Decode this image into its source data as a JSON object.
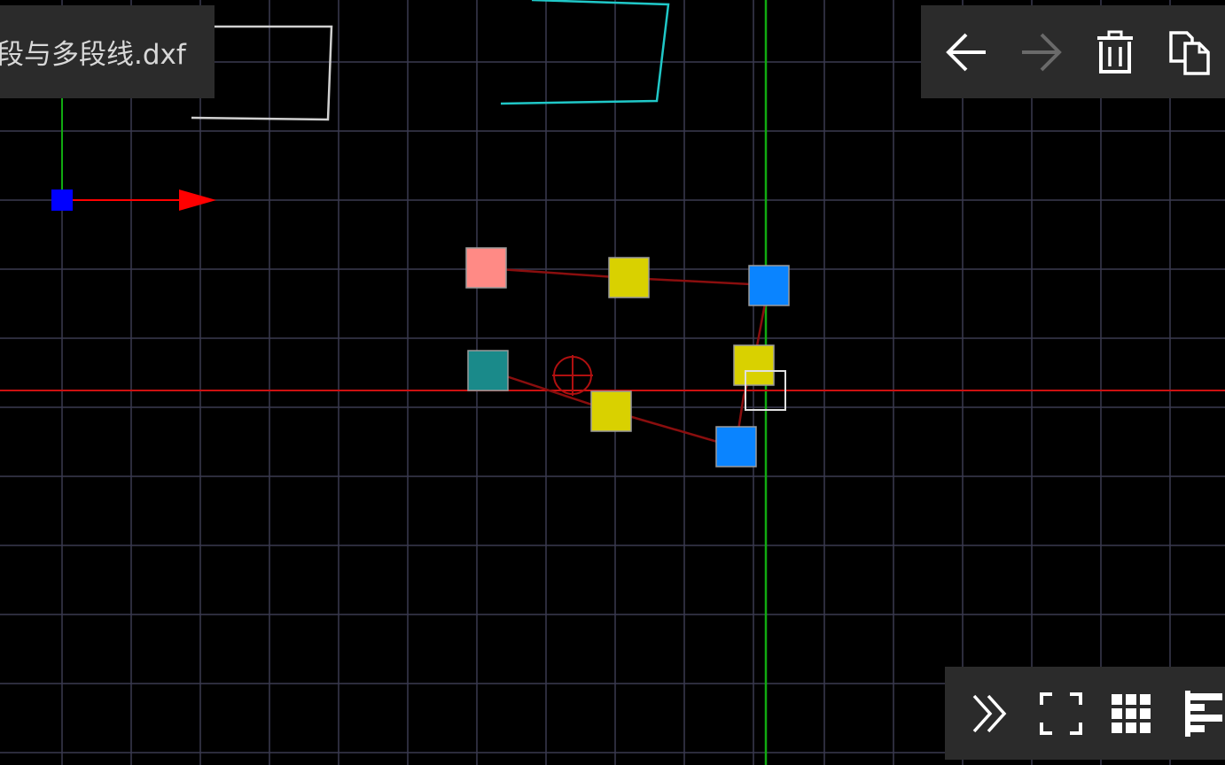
{
  "document": {
    "title": "段与多段线.dxf"
  },
  "toolbar_top": {
    "items": [
      {
        "name": "undo",
        "icon": "arrow-left-icon",
        "enabled": true
      },
      {
        "name": "redo",
        "icon": "arrow-right-icon",
        "enabled": false
      },
      {
        "name": "delete",
        "icon": "trash-icon",
        "enabled": true
      },
      {
        "name": "copy",
        "icon": "copy-icon",
        "enabled": true
      }
    ]
  },
  "toolbar_bottom": {
    "items": [
      {
        "name": "expand",
        "icon": "double-chevron-right-icon"
      },
      {
        "name": "fullscreen",
        "icon": "fullscreen-icon"
      },
      {
        "name": "grid",
        "icon": "grid-icon"
      },
      {
        "name": "align",
        "icon": "align-left-icon"
      }
    ]
  },
  "colors": {
    "background": "#000000",
    "grid": "#3a3a50",
    "x_axis": "#cc1111",
    "y_axis": "#11aa11",
    "panel": "#2b2b2b",
    "grip_pink": "#ff8a85",
    "grip_yellow": "#d9d100",
    "grip_blue": "#0a84ff",
    "grip_teal": "#1a8a8a",
    "polyline": "#8a0e0e",
    "cyan_entity": "#20c8c8",
    "white_entity": "#d0d0d0",
    "ucs_origin": "#0000ff",
    "ucs_arrow": "#ff0000"
  }
}
